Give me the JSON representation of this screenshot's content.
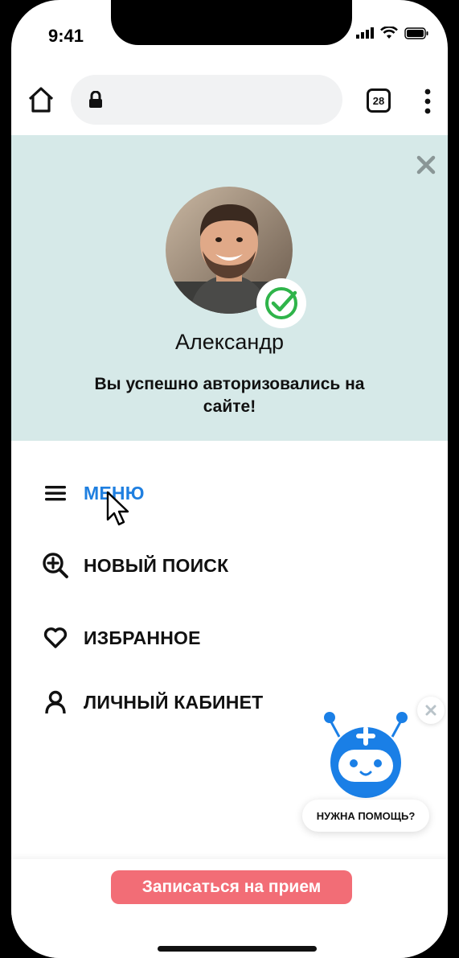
{
  "status": {
    "time": "9:41"
  },
  "browser": {
    "tab_count": "28"
  },
  "auth": {
    "user_name": "Александр",
    "message": "Вы успешно авторизовались на сайте!"
  },
  "menu": {
    "items": [
      {
        "label": "МЕНЮ",
        "icon": "hamburger-icon",
        "active": true
      },
      {
        "label": "НОВЫЙ ПОИСК",
        "icon": "zoom-in-icon"
      },
      {
        "label": "ИЗБРАННОЕ",
        "icon": "heart-icon"
      },
      {
        "label": "ЛИЧНЫЙ КАБИНЕТ",
        "icon": "user-icon"
      }
    ]
  },
  "helper": {
    "label": "НУЖНА ПОМОЩЬ?"
  },
  "cta": {
    "label": "Записаться на прием"
  },
  "colors": {
    "panel_bg": "#d6e9e8",
    "accent_blue": "#1f7fe0",
    "cta_pink": "#f26d76",
    "check_green": "#2fb44a"
  }
}
